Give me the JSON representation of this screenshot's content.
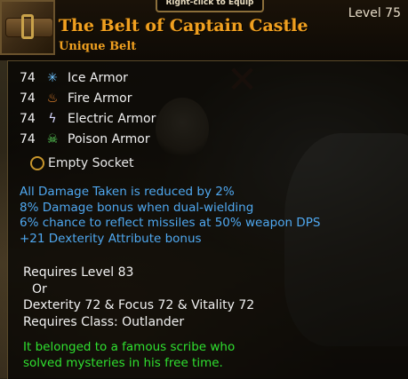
{
  "header": {
    "equip_hint": "Right-click to Equip",
    "item_name": "The Belt of Captain Castle",
    "item_type": "Unique Belt",
    "level": "Level 75"
  },
  "armor": [
    {
      "value": "74",
      "icon": "ice-icon",
      "label": "Ice Armor"
    },
    {
      "value": "74",
      "icon": "fire-icon",
      "label": "Fire Armor"
    },
    {
      "value": "74",
      "icon": "electric-icon",
      "label": "Electric Armor"
    },
    {
      "value": "74",
      "icon": "poison-icon",
      "label": "Poison Armor"
    }
  ],
  "socket": {
    "label": "Empty Socket"
  },
  "bonuses": [
    "All Damage Taken is reduced by 2%",
    "8% Damage bonus when dual-wielding",
    "6% chance to reflect missiles at 50% weapon DPS",
    "+21 Dexterity Attribute bonus"
  ],
  "requirements": [
    "Requires Level 83",
    "Or",
    "Dexterity 72 & Focus 72 & Vitality 72",
    "Requires Class: Outlander"
  ],
  "flavor": [
    "It belonged to a famous scribe who",
    "solved mysteries in his free time."
  ],
  "colors": {
    "item_name": "#f0a020",
    "bonus_text": "#4fa8f0",
    "flavor_text": "#2fe02f"
  }
}
